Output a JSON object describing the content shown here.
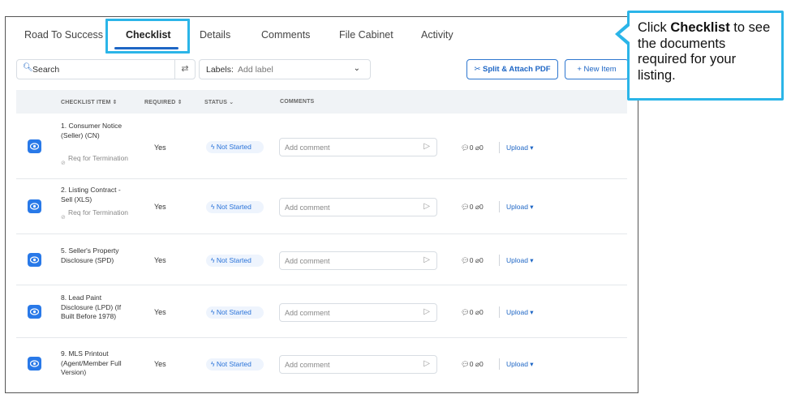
{
  "tabs": [
    "Road To Success",
    "Checklist",
    "Details",
    "Comments",
    "File Cabinet",
    "Activity"
  ],
  "active_tab": "Checklist",
  "toolbar": {
    "search_placeholder": "Search",
    "labels_label": "Labels:",
    "labels_placeholder": "Add label",
    "split_attach_label": "Split & Attach PDF",
    "new_item_label": "+ New Item"
  },
  "table": {
    "headers": {
      "item": "CHECKLIST ITEM ⇕",
      "required": "REQUIRED ⇕",
      "status": "STATUS ⌄",
      "comments": "COMMENTS"
    },
    "rows": [
      {
        "name": "1. Consumer Notice (Seller) (CN)",
        "sub": "Req for Termination",
        "required": "Yes",
        "status": "Not Started",
        "comment_placeholder": "Add comment",
        "comments_count": "0",
        "attachments_count": "0",
        "upload": "Upload ▾"
      },
      {
        "name": "2. Listing Contract - Sell (XLS)",
        "sub": "Req for Termination",
        "required": "Yes",
        "status": "Not Started",
        "comment_placeholder": "Add comment",
        "comments_count": "0",
        "attachments_count": "0",
        "upload": "Upload ▾"
      },
      {
        "name": "5. Seller's Property Disclosure (SPD)",
        "sub": "",
        "required": "Yes",
        "status": "Not Started",
        "comment_placeholder": "Add comment",
        "comments_count": "0",
        "attachments_count": "0",
        "upload": "Upload ▾"
      },
      {
        "name": "8. Lead Paint Disclosure (LPD) (If Built Before 1978)",
        "sub": "",
        "required": "Yes",
        "status": "Not Started",
        "comment_placeholder": "Add comment",
        "comments_count": "0",
        "attachments_count": "0",
        "upload": "Upload ▾"
      },
      {
        "name": "9. MLS Printout (Agent/Member Full Version)",
        "sub": "",
        "required": "Yes",
        "status": "Not Started",
        "comment_placeholder": "Add comment",
        "comments_count": "0",
        "attachments_count": "0",
        "upload": "Upload ▾"
      }
    ]
  },
  "callout": {
    "prefix": "Click ",
    "bold": "Checklist",
    "suffix": " to see the documents required for your listing."
  },
  "colors": {
    "accent": "#1e66c5",
    "highlight": "#2bb5e8",
    "eye_button": "#2979e8"
  },
  "icons": [
    "search-icon",
    "swap-icon",
    "chevron-down-icon",
    "scissors-icon",
    "eye-icon",
    "tag-icon",
    "send-icon",
    "comment-icon",
    "paperclip-icon"
  ]
}
